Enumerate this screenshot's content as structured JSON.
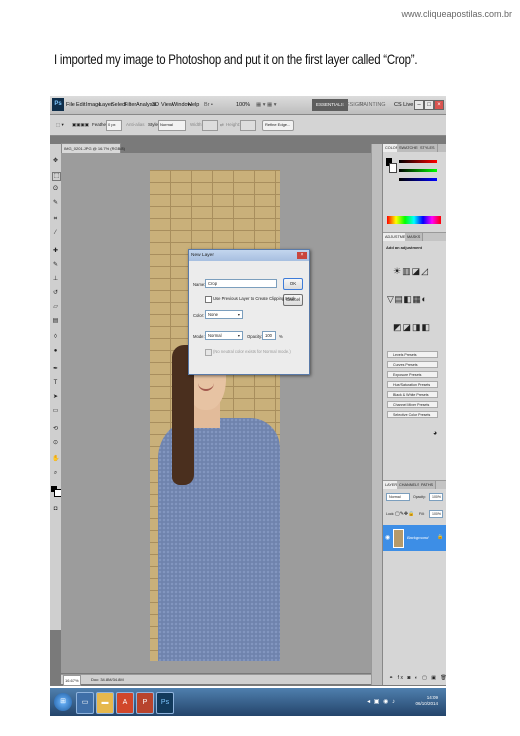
{
  "site": "www.cliqueapostilas.com.br",
  "caption": "I imported my image to Photoshop and put it on the first layer called “Crop”.",
  "photoshop": {
    "menu": [
      "File",
      "Edit",
      "Image",
      "Layer",
      "Select",
      "Filter",
      "Analysis",
      "3D",
      "View",
      "Window",
      "Help"
    ],
    "zoom": "100%",
    "workspace": {
      "essentials": "ESSENTIALS",
      "design": "DESIGN",
      "painting": "PAINTING"
    },
    "cs_live": "CS Live",
    "options": {
      "feather_label": "Feather:",
      "feather_value": "0 px",
      "antialias": "Anti-alias",
      "style_label": "Style:",
      "style_value": "Normal",
      "width_label": "Width:",
      "height_label": "Height:",
      "refine": "Refine Edge..."
    },
    "doc_tab": "IMG_0201.JPG @ 16.7% (RGB/8)",
    "status": {
      "zoom": "16.67%",
      "doc": "Doc: 34.8M/34.8M"
    },
    "dialog": {
      "title": "New Layer",
      "name_label": "Name:",
      "name_value": "Crop",
      "ok": "OK",
      "cancel": "Cancel",
      "use_previous": "Use Previous Layer to Create Clipping Mask",
      "color_label": "Color:",
      "color_value": "None",
      "mode_label": "Mode:",
      "mode_value": "Normal",
      "opacity_label": "Opacity:",
      "opacity_value": "100",
      "opacity_unit": "%",
      "neutral": "(No neutral color exists for Normal mode.)"
    },
    "panels": {
      "color_tabs": [
        "COLOR",
        "SWATCHES",
        "STYLES"
      ],
      "adjust_tabs": [
        "ADJUSTMENTS",
        "MASKS"
      ],
      "add_adjustment": "Add an adjustment",
      "presets": [
        "Levels Presets",
        "Curves Presets",
        "Exposure Presets",
        "Hue/Saturation Presets",
        "Black & White Presets",
        "Channel Mixer Presets",
        "Selective Color Presets"
      ],
      "layer_tabs": [
        "LAYERS",
        "CHANNELS",
        "PATHS"
      ],
      "blend": "Normal",
      "opacity_label": "Opacity:",
      "opacity": "100%",
      "lock_label": "Lock:",
      "fill_label": "Fill:",
      "fill": "100%",
      "layer_name": "Background"
    },
    "taskbar": {
      "time": "14:09",
      "date": "06/10/2014"
    }
  }
}
